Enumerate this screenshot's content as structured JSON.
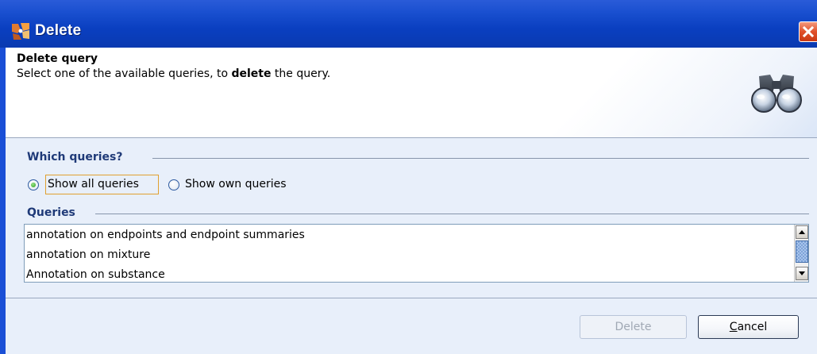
{
  "window": {
    "title": "Delete",
    "close_icon": "close-icon",
    "app_icon": "app-logo-icon"
  },
  "header": {
    "title": "Delete query",
    "description_before": "Select one of the available queries, to ",
    "description_bold": "delete",
    "description_after": " the query.",
    "icon": "binoculars-icon"
  },
  "scope": {
    "label": "Which queries?",
    "options": [
      {
        "label": "Show all queries",
        "selected": true
      },
      {
        "label": "Show own queries",
        "selected": false
      }
    ]
  },
  "queries": {
    "label": "Queries",
    "items": [
      "annotation on endpoints and endpoint summaries",
      "annotation on mixture",
      "Annotation on substance"
    ]
  },
  "buttons": {
    "delete_label": "Delete",
    "cancel_mnemonic": "C",
    "cancel_rest": "ancel"
  },
  "colors": {
    "titlebar": "#0a3fc0",
    "section_label": "#1f3a78",
    "radio_selected": "#2aa21c"
  }
}
